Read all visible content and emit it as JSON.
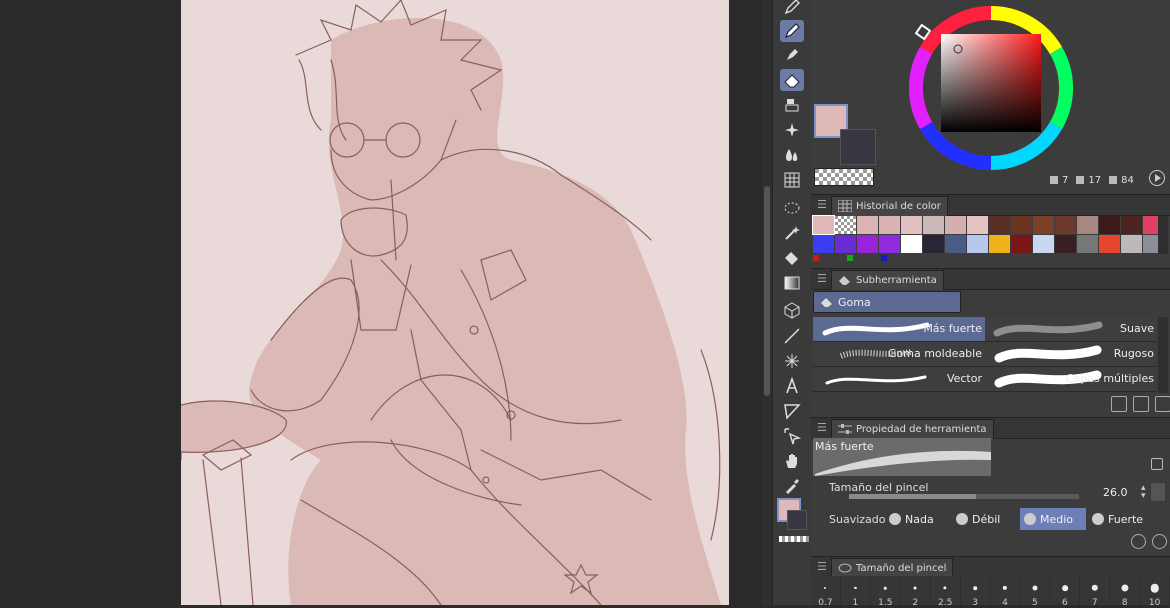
{
  "colors": {
    "main": "#deb9b7",
    "sub": "#383640",
    "accent": "#6d7fb8",
    "canvas_bg": "#ead9d9",
    "line_art": "#7a4a44"
  },
  "color_wheel": {
    "readout": {
      "h": "7",
      "s": "17",
      "v": "84"
    }
  },
  "history": {
    "title": "Historial de color",
    "swatches_row1": [
      "#deb9b7",
      "transparent",
      "#dbb4b4",
      "#d9b3b3",
      "#e2c0bf",
      "#cbb8b8",
      "#d3b0ae",
      "#e6c3c2",
      "#5a2e22",
      "#6b3522",
      "#7b4027",
      "#6a3a2c",
      "#a88783",
      "#3a1a1a",
      "#4d2320",
      "#e04068"
    ],
    "swatches_row2": [
      "#3b3df0",
      "#6b2bd4",
      "#9a22d8",
      "#8e2cde",
      "#ffffff",
      "#2a2535",
      "#4b5b86",
      "#b6c8ee",
      "#f0b21a",
      "#7c1616",
      "#c8d8f0",
      "#3b1e22",
      "#777777",
      "#e84530",
      "#bfb8b8",
      "#8e8e9a"
    ],
    "markers": [
      "#c81818",
      "#14a814",
      "#1818c8"
    ]
  },
  "subtool": {
    "title": "Subherramienta",
    "group": "Goma",
    "items": [
      {
        "label": "Más fuerte"
      },
      {
        "label": "Suave"
      },
      {
        "label": "Goma moldeable"
      },
      {
        "label": "Rugoso"
      },
      {
        "label": "Vector"
      },
      {
        "label": "Capas múltiples"
      }
    ]
  },
  "tool_property": {
    "title": "Propiedad de herramienta",
    "preview_label": "Más fuerte",
    "brush_size_label": "Tamaño del pincel",
    "brush_size_value": "26.0",
    "brush_size_fraction": 0.55,
    "stabilization_label": "Suavizado",
    "stabilization_options": [
      {
        "label": "Nada",
        "selected": false
      },
      {
        "label": "Débil",
        "selected": false
      },
      {
        "label": "Medio",
        "selected": true
      },
      {
        "label": "Fuerte",
        "selected": false
      }
    ]
  },
  "brush_size_panel": {
    "title": "Tamaño del pincel",
    "sizes": [
      "0.7",
      "1",
      "1.5",
      "2",
      "2.5",
      "3",
      "4",
      "5",
      "6",
      "7",
      "8",
      "10"
    ]
  },
  "toolbar": {
    "tools": [
      "pen-icon",
      "pen-active-icon",
      "marker-icon",
      "eraser-icon",
      "blend-icon",
      "sparkle-icon",
      "fill-drop-icon",
      "transform-grid-icon",
      "lasso-select-icon",
      "magic-wand-icon",
      "fill-bucket-icon",
      "gradient-icon",
      "3d-cube-icon",
      "line-icon",
      "ruler-icon",
      "text-icon",
      "balloon-icon",
      "select-arrow-icon",
      "hand-icon",
      "eyedropper-icon"
    ]
  }
}
